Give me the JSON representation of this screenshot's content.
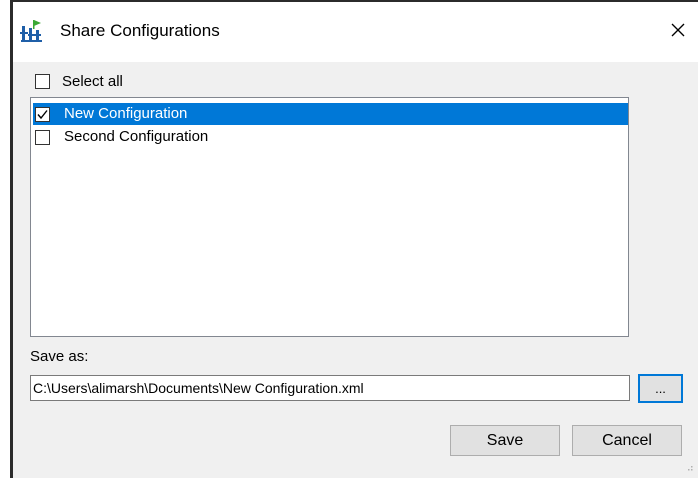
{
  "window": {
    "title": "Share Configurations",
    "app_icon": "app-logo-icon",
    "close_icon": "close-icon"
  },
  "select_all": {
    "label": "Select all",
    "checked": false
  },
  "configurations": [
    {
      "label": "New Configuration",
      "checked": true,
      "selected": true
    },
    {
      "label": "Second Configuration",
      "checked": false,
      "selected": false
    }
  ],
  "save_as": {
    "label": "Save as:",
    "path": "C:\\Users\\alimarsh\\Documents\\New Configuration.xml",
    "browse_label": "..."
  },
  "buttons": {
    "save": "Save",
    "cancel": "Cancel"
  },
  "colors": {
    "selection": "#0078d7",
    "dialog_bg": "#f0f0f0",
    "button_bg": "#e1e1e1"
  }
}
